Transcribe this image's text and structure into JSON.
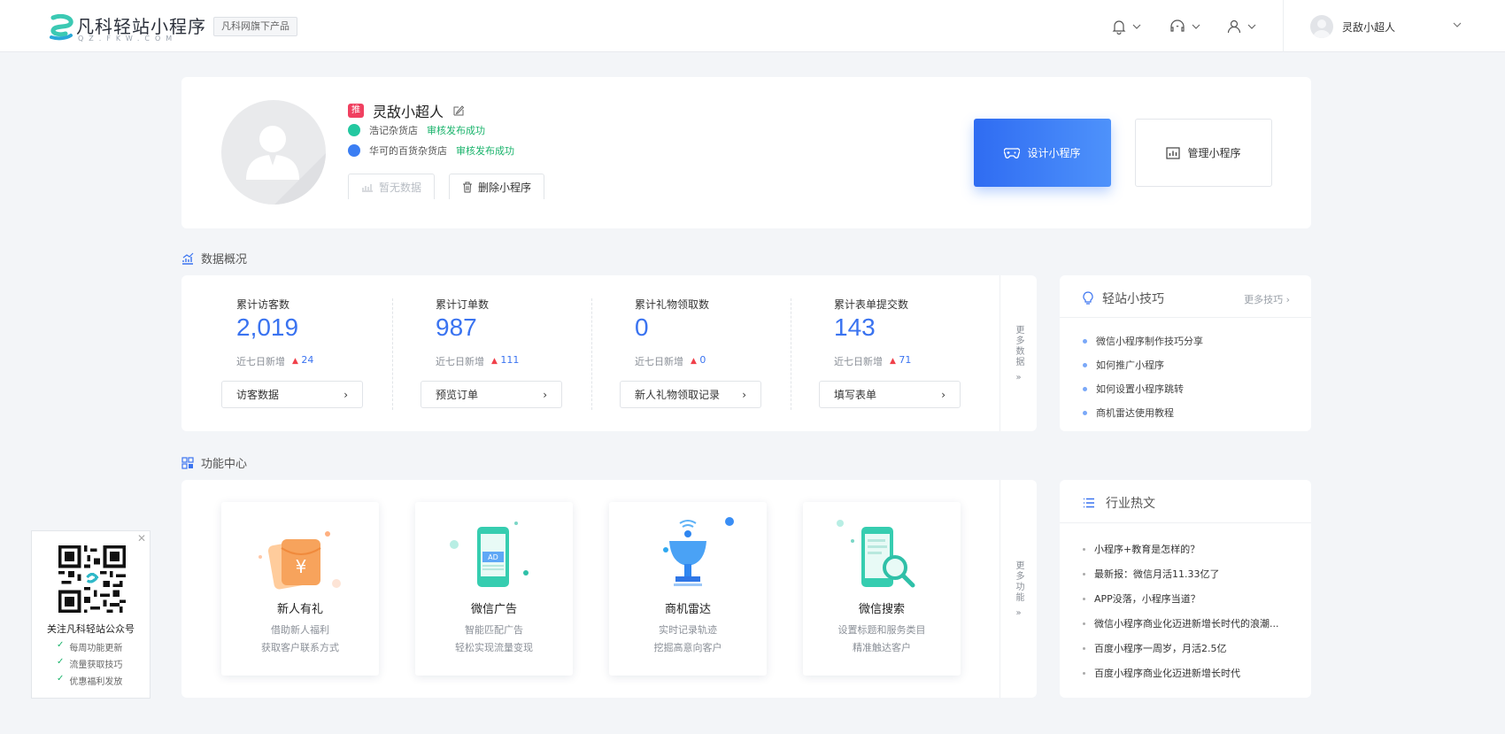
{
  "header": {
    "logo_text": "凡科轻站小程序",
    "logo_sub": "QZ.FKW.COM",
    "brand_badge": "凡科网旗下产品",
    "user_name": "灵敌小超人"
  },
  "profile": {
    "tag": "推",
    "name": "灵敌小超人",
    "lines": [
      {
        "shop": "浩记杂货店",
        "status": "审核发布成功"
      },
      {
        "shop": "华可的百货杂货店",
        "status": "审核发布成功"
      }
    ],
    "btn_no_data": "暂无数据",
    "btn_delete": "删除小程序",
    "btn_design": "设计小程序",
    "btn_manage": "管理小程序"
  },
  "stats_section": {
    "title": "数据概况",
    "more": "更多数据",
    "items": [
      {
        "label": "累计访客数",
        "value": "2,019",
        "sub": "近七日新增",
        "delta": "24",
        "btn": "访客数据"
      },
      {
        "label": "累计订单数",
        "value": "987",
        "sub": "近七日新增",
        "delta": "111",
        "btn": "预览订单"
      },
      {
        "label": "累计礼物领取数",
        "value": "0",
        "sub": "近七日新增",
        "delta": "0",
        "btn": "新人礼物领取记录"
      },
      {
        "label": "累计表单提交数",
        "value": "143",
        "sub": "近七日新增",
        "delta": "71",
        "btn": "填写表单"
      }
    ]
  },
  "tips": {
    "title": "轻站小技巧",
    "more": "更多技巧 ›",
    "items": [
      "微信小程序制作技巧分享",
      "如何推广小程序",
      "如何设置小程序跳转",
      "商机雷达使用教程"
    ]
  },
  "features_section": {
    "title": "功能中心",
    "more": "更多功能",
    "items": [
      {
        "title": "新人有礼",
        "d1": "借助新人福利",
        "d2": "获取客户联系方式"
      },
      {
        "title": "微信广告",
        "d1": "智能匹配广告",
        "d2": "轻松实现流量变现"
      },
      {
        "title": "商机雷达",
        "d1": "实时记录轨迹",
        "d2": "挖掘高意向客户"
      },
      {
        "title": "微信搜索",
        "d1": "设置标题和服务类目",
        "d2": "精准触达客户"
      }
    ]
  },
  "industry": {
    "title": "行业热文",
    "items": [
      "小程序+教育是怎样的？",
      "最新报：微信月活11.33亿了",
      "APP没落，小程序当道？",
      "微信小程序商业化迈进新增长时代的浪潮...",
      "百度小程序一周岁，月活2.5亿",
      "百度小程序商业化迈进新增长时代"
    ]
  },
  "qr_float": {
    "title": "关注凡科轻站公众号",
    "items": [
      "每周功能更新",
      "流量获取技巧",
      "优惠福利发放"
    ],
    "close": "✕"
  },
  "colors": {
    "accent": "#3a73f0",
    "success": "#19b36b",
    "up": "#f0404a"
  }
}
